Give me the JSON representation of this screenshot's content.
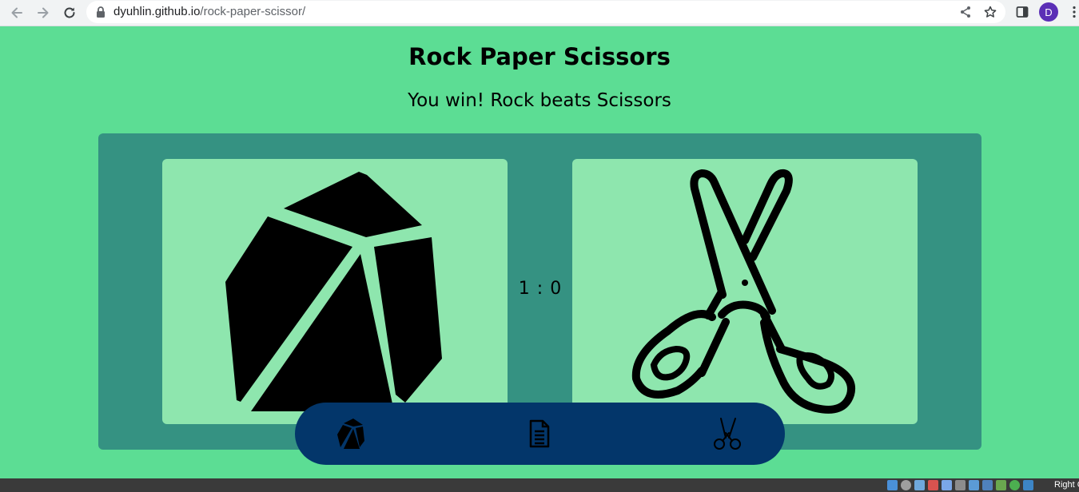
{
  "browser": {
    "url_host": "dyuhlin.github.io",
    "url_path": "/rock-paper-scissor/",
    "avatar_letter": "D",
    "icons": [
      "back-arrow-icon",
      "forward-arrow-icon",
      "reload-icon",
      "lock-icon",
      "share-icon",
      "star-icon",
      "side-panel-icon",
      "more-vert-icon"
    ]
  },
  "page": {
    "title": "Rock Paper Scissors",
    "result": "You win! Rock beats Scissors",
    "score": "1 : 0",
    "player_choice": "rock",
    "computer_choice": "scissors"
  },
  "picker": {
    "options": [
      {
        "name": "rock",
        "icon": "rock-icon"
      },
      {
        "name": "paper",
        "icon": "paper-document-icon"
      },
      {
        "name": "scissors",
        "icon": "scissors-icon"
      }
    ]
  },
  "taskbar": {
    "tray_text": "Right C"
  },
  "colors": {
    "background": "#5cdd94",
    "board": "#359282",
    "card": "#8ee6ae",
    "picker": "#03366a"
  }
}
